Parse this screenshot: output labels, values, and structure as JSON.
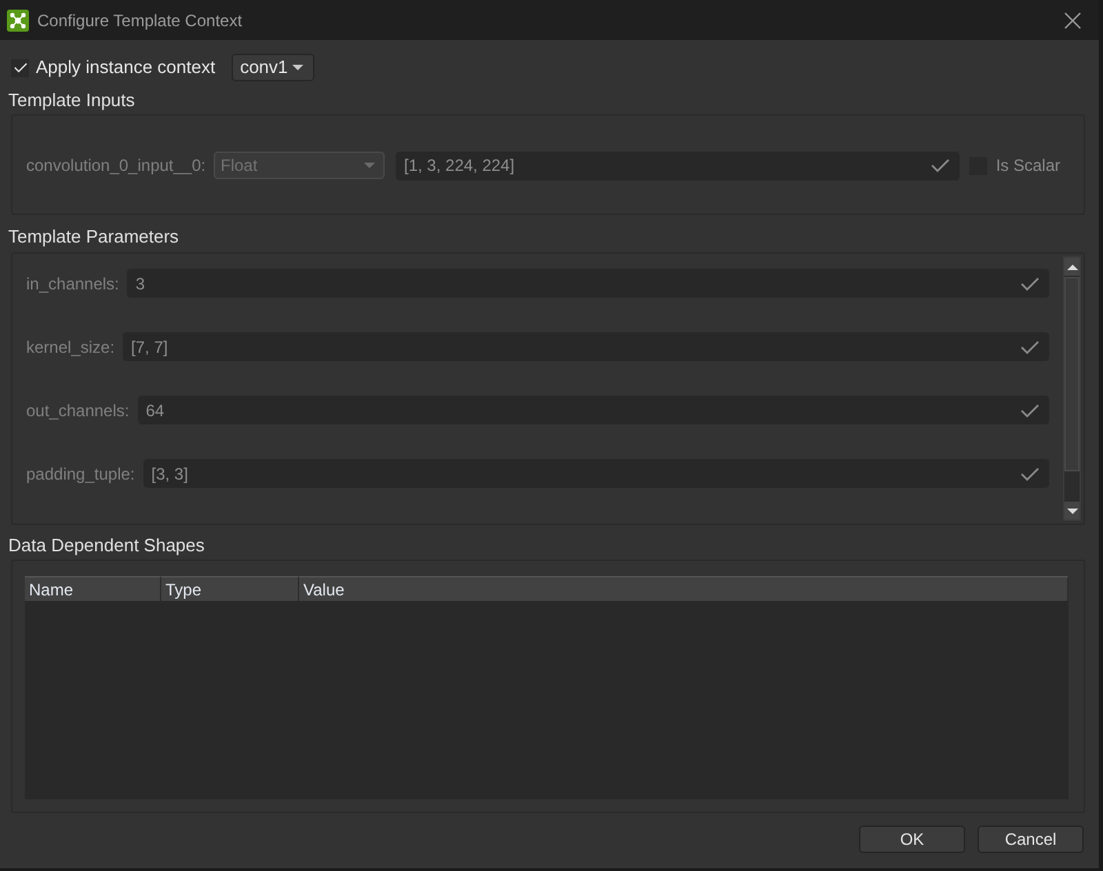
{
  "window": {
    "title": "Configure Template Context"
  },
  "instance_context": {
    "label": "Apply instance context",
    "checked": true,
    "dropdown": {
      "value": "conv1"
    }
  },
  "template_inputs": {
    "title": "Template Inputs",
    "inputs": [
      {
        "label": "convolution_0_input__0:",
        "type": {
          "value": "Float",
          "disabled": true
        },
        "value": "[1, 3, 224, 224]",
        "valid": true,
        "is_scalar": {
          "label": "Is Scalar",
          "checked": false
        }
      }
    ]
  },
  "template_parameters": {
    "title": "Template Parameters",
    "params": [
      {
        "label": "in_channels:",
        "value": "3",
        "valid": true
      },
      {
        "label": "kernel_size:",
        "value": "[7, 7]",
        "valid": true
      },
      {
        "label": "out_channels:",
        "value": "64",
        "valid": true
      },
      {
        "label": "padding_tuple:",
        "value": "[3, 3]",
        "valid": true
      }
    ]
  },
  "data_dependent_shapes": {
    "title": "Data Dependent Shapes",
    "table": {
      "columns": [
        "Name",
        "Type",
        "Value"
      ]
    }
  },
  "buttons": [
    {
      "label": "OK"
    },
    {
      "label": "Cancel"
    }
  ]
}
